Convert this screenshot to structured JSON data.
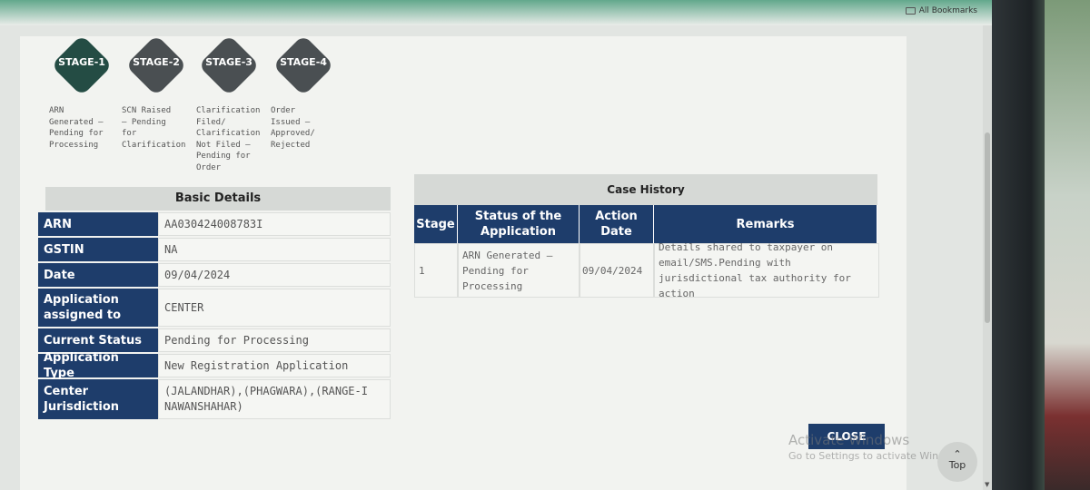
{
  "browser": {
    "bookmarks_label": "All Bookmarks"
  },
  "stages": [
    {
      "label": "STAGE-1",
      "desc": "ARN Generated – Pending for Processing",
      "active": true
    },
    {
      "label": "STAGE-2",
      "desc": "SCN Raised – Pending for Clarification",
      "active": false
    },
    {
      "label": "STAGE-3",
      "desc": "Clarification Filed/ Clarification Not Filed – Pending for Order",
      "active": false
    },
    {
      "label": "STAGE-4",
      "desc": "Order Issued – Approved/ Rejected",
      "active": false
    }
  ],
  "basic_details": {
    "title": "Basic Details",
    "rows": [
      {
        "key": "ARN",
        "value": "AA030424008783I"
      },
      {
        "key": "GSTIN",
        "value": "NA"
      },
      {
        "key": "Date",
        "value": "09/04/2024"
      },
      {
        "key": "Application assigned to",
        "value": "CENTER"
      },
      {
        "key": "Current Status",
        "value": "Pending for Processing"
      },
      {
        "key": "Application Type",
        "value": "New Registration Application"
      },
      {
        "key": "Center Jurisdiction",
        "value": "(JALANDHAR),(PHAGWARA),(RANGE-I NAWANSHAHAR)"
      }
    ]
  },
  "case_history": {
    "title": "Case History",
    "headers": [
      "Stage",
      "Status of the Application",
      "Action Date",
      "Remarks"
    ],
    "rows": [
      {
        "stage": "1",
        "status": "ARN Generated – Pending for Processing",
        "date": "09/04/2024",
        "remarks": "Details shared to taxpayer on email/SMS.Pending with jurisdictional tax authority for action"
      }
    ]
  },
  "close_label": "CLOSE",
  "watermark": {
    "title": "Activate Windows",
    "subtitle": "Go to Settings to activate Windows."
  },
  "top_label": "Top"
}
